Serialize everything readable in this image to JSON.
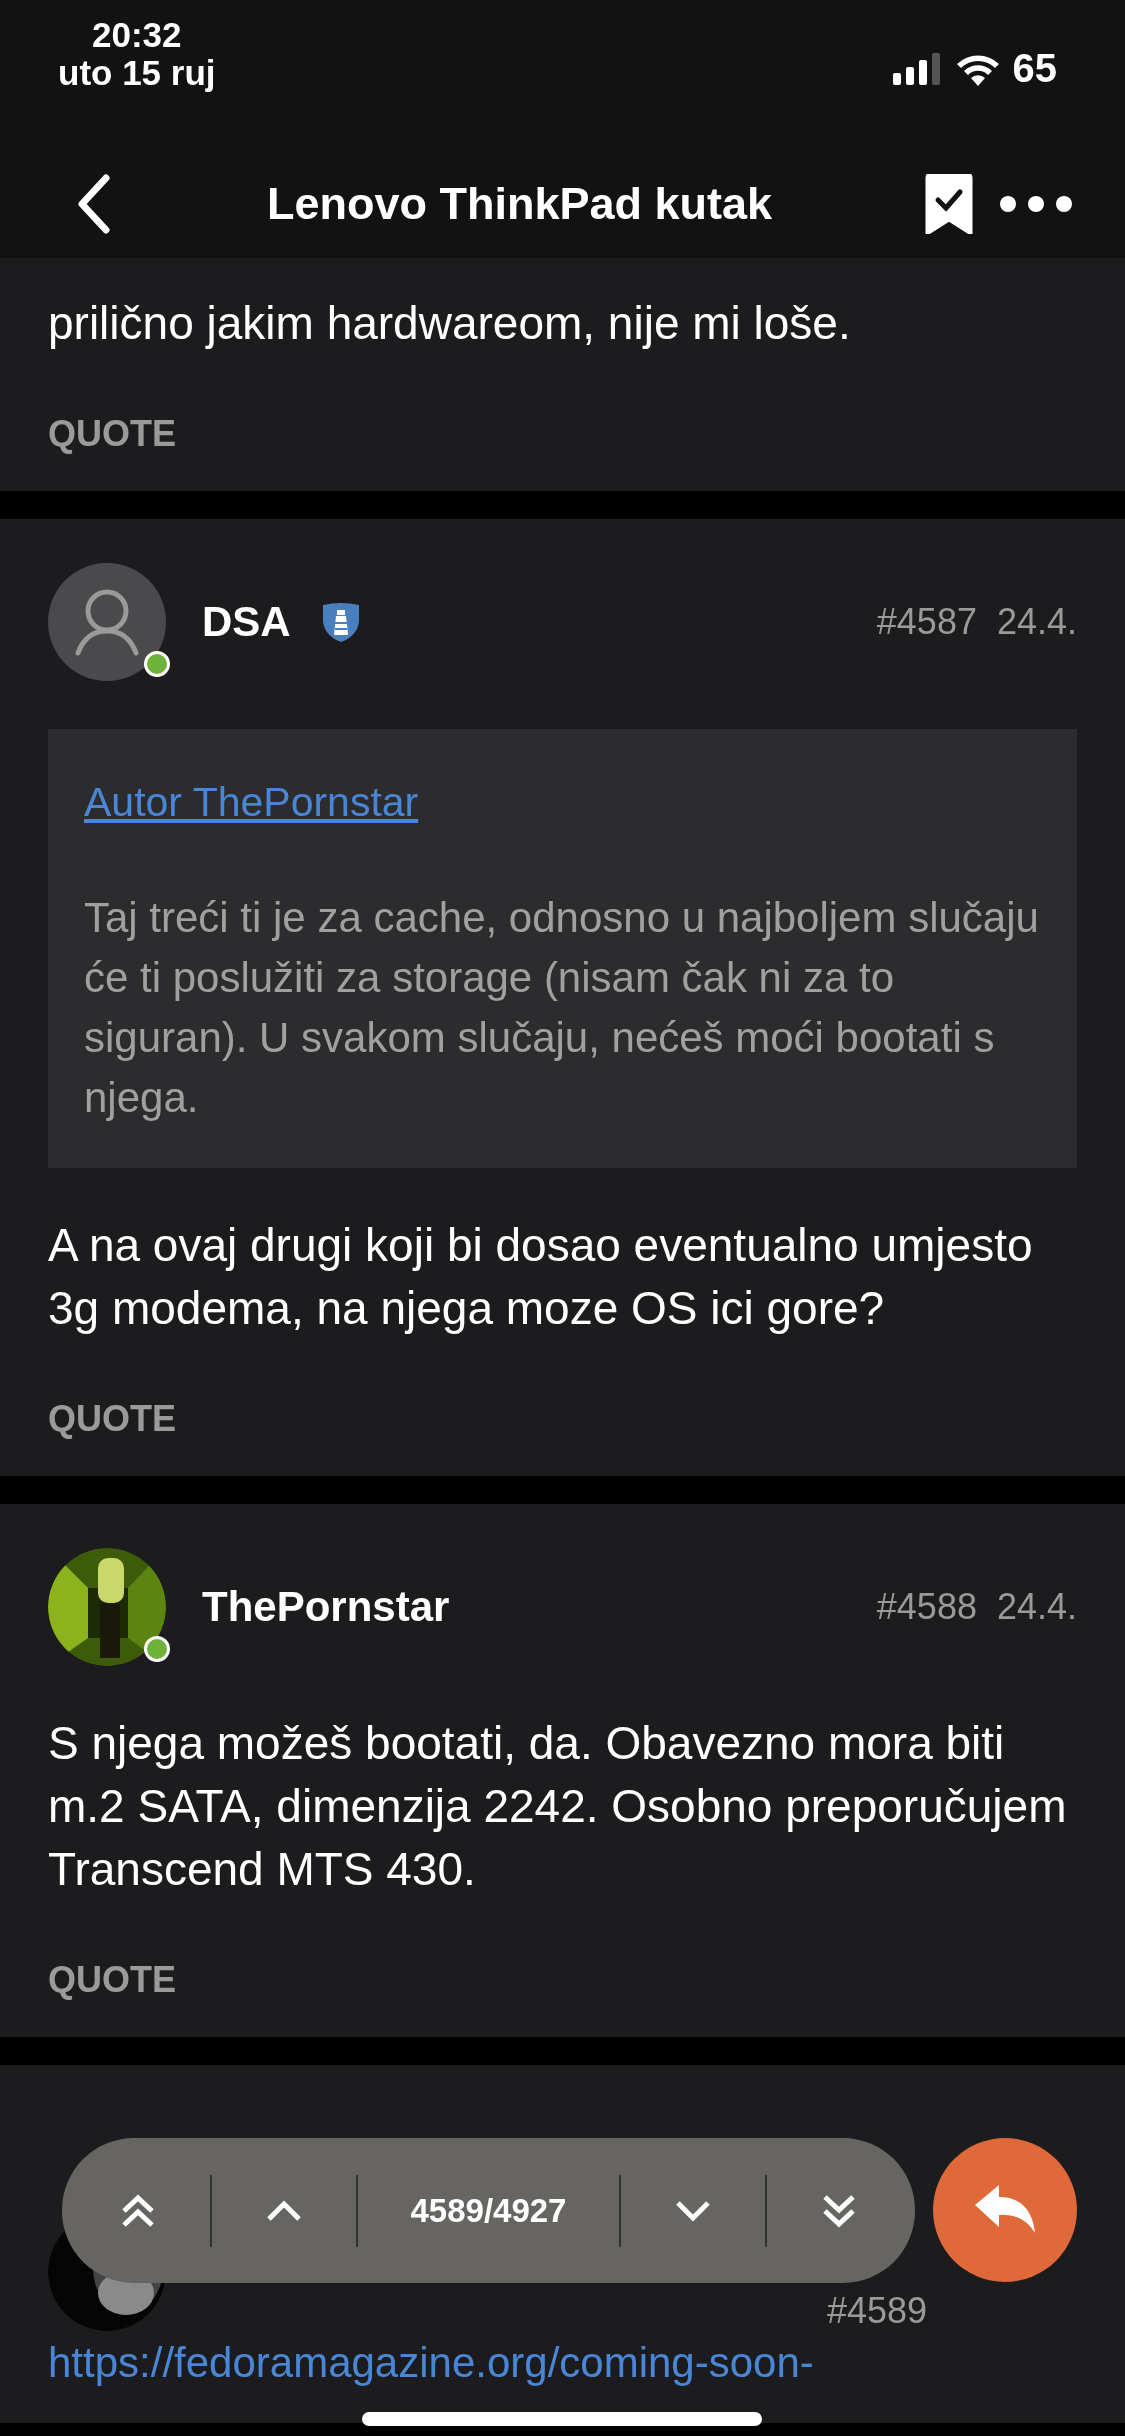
{
  "status_bar": {
    "time": "20:32",
    "date": "uto 15 ruj",
    "battery": "65"
  },
  "nav_bar": {
    "title": "Lenovo ThinkPad kutak",
    "bookmarked": true
  },
  "posts": [
    {
      "kind": "fragment",
      "body": "prilično jakim hardwareom, nije mi loše.",
      "quote_action": "QUOTE"
    },
    {
      "kind": "post",
      "author": "DSA",
      "moderator_badge": true,
      "online": true,
      "avatar": {
        "kind": "default"
      },
      "number": "#4587",
      "date": "24.4.",
      "quote": {
        "author_link": "Autor ThePornstar",
        "text": "Taj treći ti je za cache, odnosno u najboljem slučaju će ti poslužiti za storage (nisam čak ni za to siguran). U svakom slučaju, nećeš moći bootati s njega."
      },
      "body": "A na ovaj drugi koji bi dosao eventualno umjesto 3g modema, na njega moze OS ici gore?",
      "quote_action": "QUOTE"
    },
    {
      "kind": "post",
      "author": "ThePornstar",
      "moderator_badge": false,
      "online": true,
      "number": "#4588",
      "date": "24.4.",
      "body": "S njega možeš bootati, da. Obavezno mora biti m.2 SATA, dimenzija 2242. Osobno preporučujem Transcend MTS 430.",
      "quote_action": "QUOTE"
    },
    {
      "kind": "partial",
      "number": "#4589",
      "link": "https://fedoramagazine.org/coming-soon-"
    }
  ],
  "pager": {
    "position": "4589/4927"
  }
}
